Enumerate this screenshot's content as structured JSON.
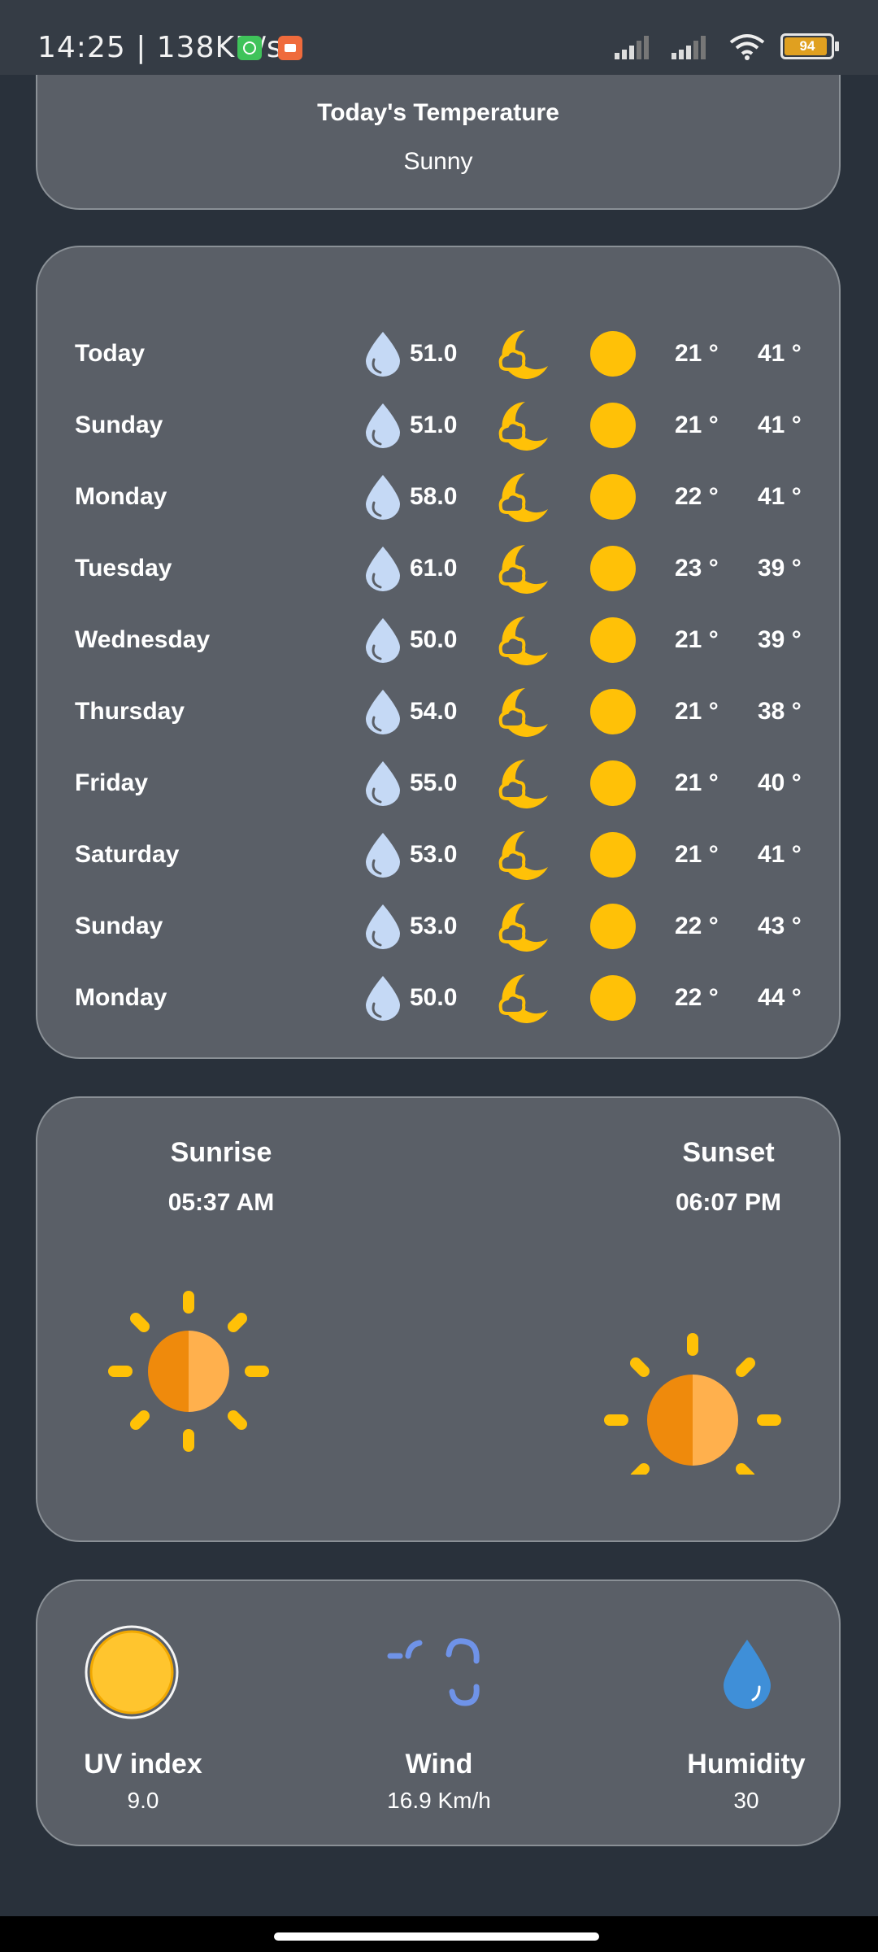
{
  "status_bar": {
    "time": "14:25 | 138KB/s",
    "battery": "94",
    "icons": [
      "whatsapp-icon",
      "recorder-icon",
      "signal-icon",
      "signal-icon",
      "wifi-icon",
      "battery-icon"
    ]
  },
  "today": {
    "title": "Today's Temperature",
    "condition": "Sunny"
  },
  "forecast": [
    {
      "day": "Today",
      "precip": "51.0",
      "min": "21 °",
      "max": "41 °"
    },
    {
      "day": "Sunday",
      "precip": "51.0",
      "min": "21 °",
      "max": "41 °"
    },
    {
      "day": "Monday",
      "precip": "58.0",
      "min": "22 °",
      "max": "41 °"
    },
    {
      "day": "Tuesday",
      "precip": "61.0",
      "min": "23 °",
      "max": "39 °"
    },
    {
      "day": "Wednesday",
      "precip": "50.0",
      "min": "21 °",
      "max": "39 °"
    },
    {
      "day": "Thursday",
      "precip": "54.0",
      "min": "21 °",
      "max": "38 °"
    },
    {
      "day": "Friday",
      "precip": "55.0",
      "min": "21 °",
      "max": "40 °"
    },
    {
      "day": "Saturday",
      "precip": "53.0",
      "min": "21 °",
      "max": "41 °"
    },
    {
      "day": "Sunday",
      "precip": "53.0",
      "min": "22 °",
      "max": "43 °"
    },
    {
      "day": "Monday",
      "precip": "50.0",
      "min": "22 °",
      "max": "44 °"
    }
  ],
  "sun": {
    "sunrise_label": "Sunrise",
    "sunrise_time": "05:37 AM",
    "sunset_label": "Sunset",
    "sunset_time": "06:07 PM"
  },
  "stats": {
    "uv_label": "UV index",
    "uv_value": "9.0",
    "wind_label": "Wind",
    "wind_value": "16.9 Km/h",
    "humidity_label": "Humidity",
    "humidity_value": "30"
  },
  "colors": {
    "background": "#29313b",
    "card": "#5a5f67",
    "sun": "#ffc107",
    "drop": "#c5d9f5",
    "sun_orange": "#ef8a0c"
  }
}
